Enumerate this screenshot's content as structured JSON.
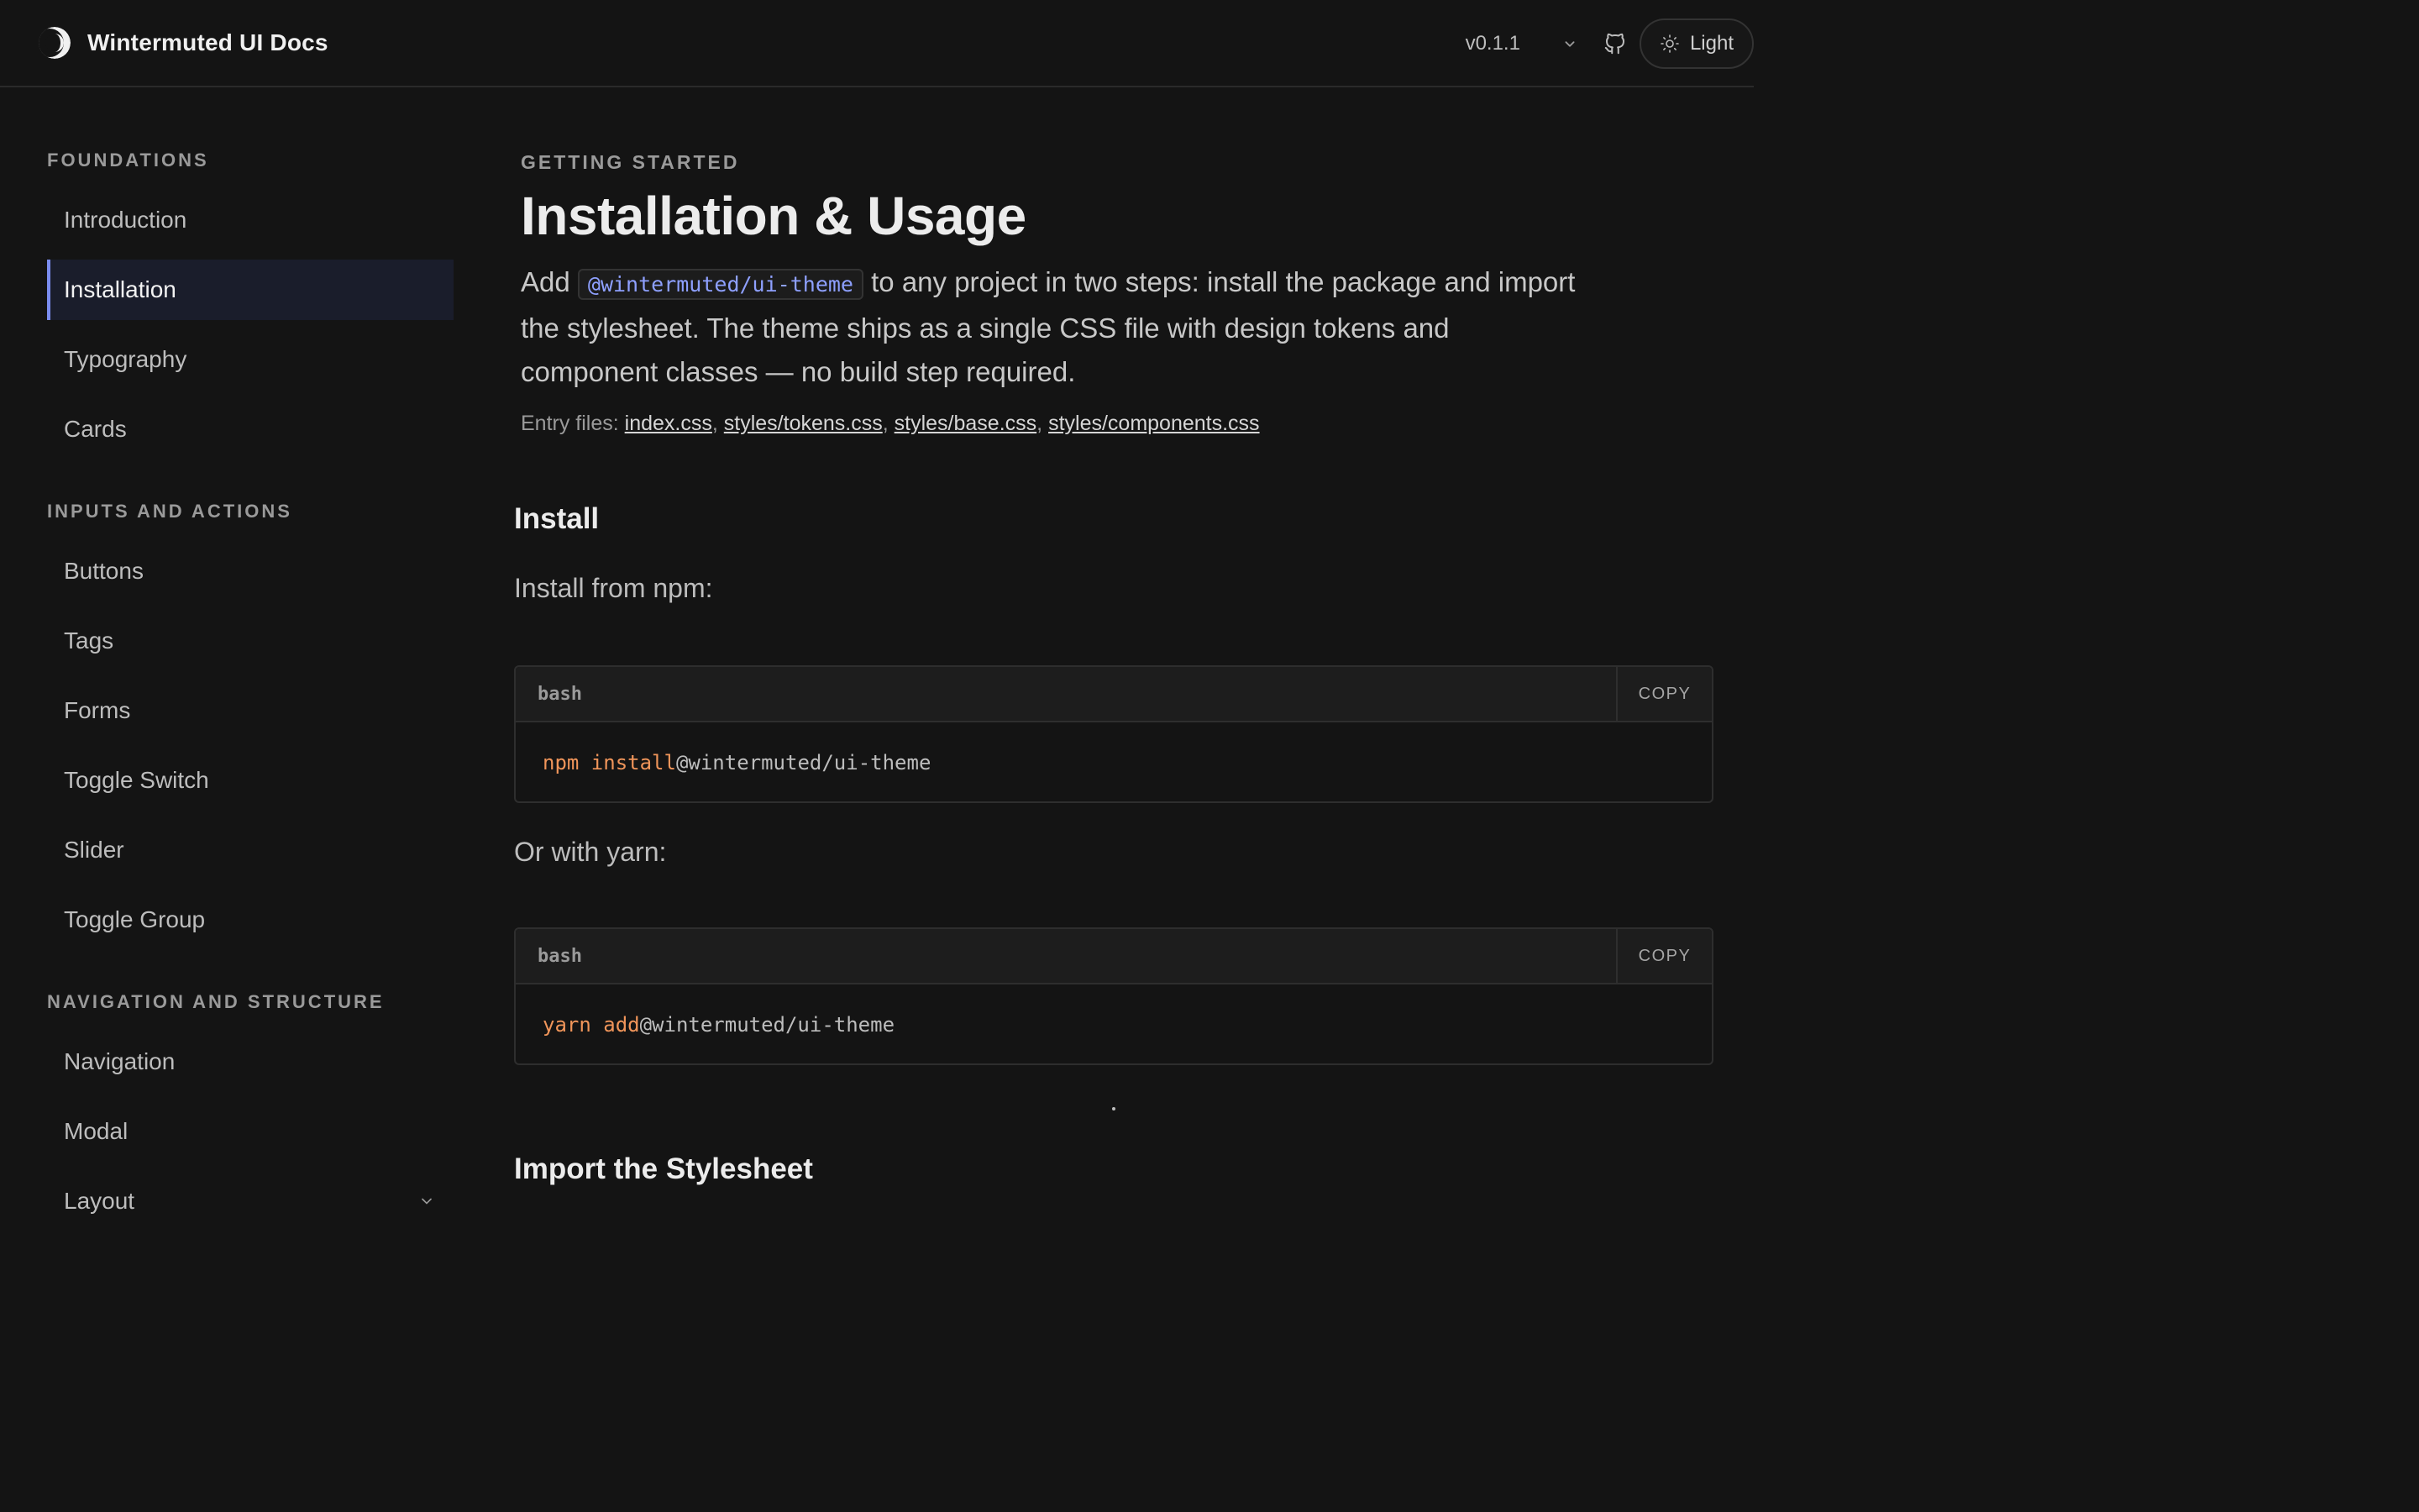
{
  "header": {
    "title": "Wintermuted UI Docs",
    "version": "v0.1.1",
    "theme_label": "Light",
    "icons": {
      "logo": "half-moon-icon",
      "version_caret": "chevron-down-icon",
      "github": "github-icon",
      "theme": "sun-icon"
    }
  },
  "sidebar": {
    "sections": [
      {
        "title": "FOUNDATIONS",
        "items": [
          "Introduction",
          "Installation",
          "Typography",
          "Cards"
        ]
      },
      {
        "title": "INPUTS AND ACTIONS",
        "items": [
          "Buttons",
          "Tags",
          "Forms",
          "Toggle Switch",
          "Slider",
          "Toggle Group"
        ]
      },
      {
        "title": "NAVIGATION AND STRUCTURE",
        "items": [
          "Navigation",
          "Modal",
          "Layout"
        ]
      }
    ],
    "active_item": "Installation"
  },
  "main": {
    "eyebrow": "GETTING STARTED",
    "title": "Installation & Usage",
    "lead": {
      "before": "Add",
      "code": "@wintermuted/ui-theme",
      "after": "to any project in two steps: install the package and import the stylesheet. The theme ships as a single CSS file with design tokens and component classes — no build step required."
    },
    "entry": {
      "label": "Entry files:",
      "files": [
        "index.css",
        "styles/tokens.css",
        "styles/base.css",
        "styles/components.css"
      ]
    },
    "install": {
      "heading": "Install",
      "npm_text": "Install from npm:",
      "npm_block": {
        "lang": "bash",
        "copy": "COPY",
        "cmd": "npm install",
        "arg": "@wintermuted/ui-theme"
      },
      "yarn_text": "Or with yarn:",
      "yarn_block": {
        "lang": "bash",
        "copy": "COPY",
        "cmd": "yarn add",
        "arg": "@wintermuted/ui-theme"
      }
    },
    "import_heading": "Import the Stylesheet"
  },
  "colors": {
    "background": "#141414",
    "accent": "#7b8df0",
    "code_keyword": "#f0955a",
    "inline_code": "#8ea0ff"
  }
}
